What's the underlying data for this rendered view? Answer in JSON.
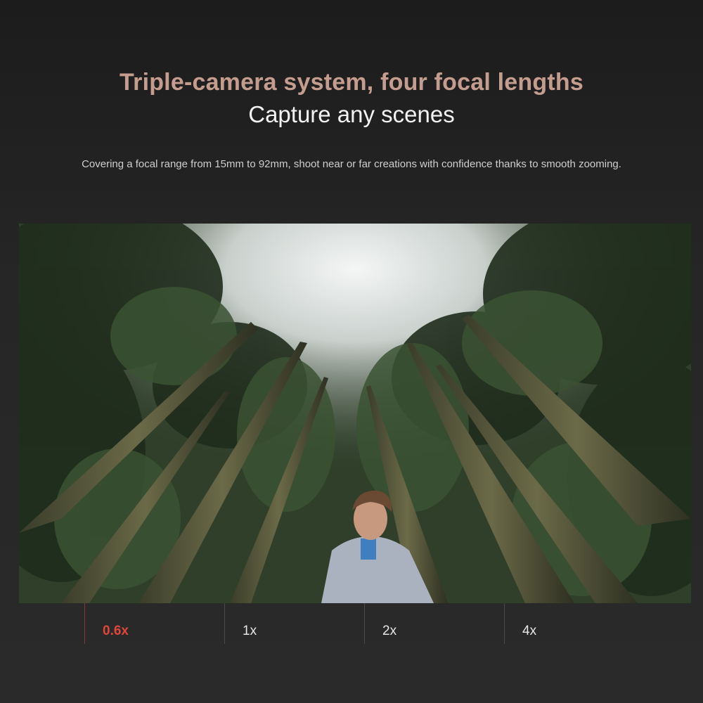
{
  "header": {
    "headline": "Triple-camera system, four focal lengths",
    "subhead": "Capture any scenes",
    "description": "Covering a focal range from 15mm to 92mm, shoot near or far creations with confidence thanks to smooth zooming."
  },
  "zoom_tabs": [
    {
      "label": "0.6x",
      "active": true
    },
    {
      "label": "1x",
      "active": false
    },
    {
      "label": "2x",
      "active": false
    },
    {
      "label": "4x",
      "active": false
    }
  ],
  "colors": {
    "headline": "#c49d8f",
    "active_tab": "#e0453b",
    "background": "#262626"
  }
}
